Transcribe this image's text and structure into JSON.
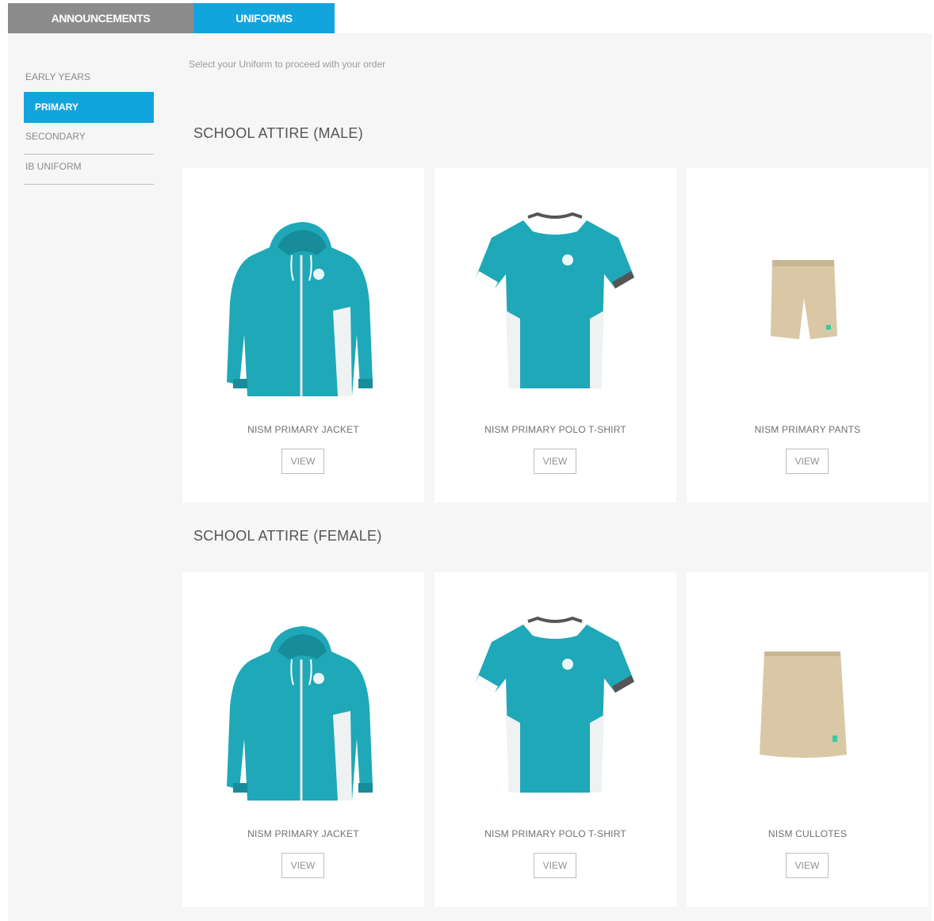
{
  "tabs": [
    {
      "label": "ANNOUNCEMENTS"
    },
    {
      "label": "UNIFORMS"
    }
  ],
  "sidebar": {
    "items": [
      {
        "label": "EARLY YEARS"
      },
      {
        "label": "PRIMARY"
      },
      {
        "label": "SECONDARY"
      },
      {
        "label": "IB UNIFORM"
      }
    ]
  },
  "intro": "Select your Uniform to proceed with your order",
  "sections": [
    {
      "title": "SCHOOL ATTIRE (MALE)",
      "products": [
        {
          "name": "NISM PRIMARY JACKET",
          "button": "VIEW"
        },
        {
          "name": "NISM PRIMARY POLO T-SHIRT",
          "button": "VIEW"
        },
        {
          "name": "NISM PRIMARY PANTS",
          "button": "VIEW"
        }
      ]
    },
    {
      "title": "SCHOOL ATTIRE (FEMALE)",
      "products": [
        {
          "name": "NISM PRIMARY JACKET",
          "button": "VIEW"
        },
        {
          "name": "NISM PRIMARY POLO T-SHIRT",
          "button": "VIEW"
        },
        {
          "name": "NISM CULLOTES",
          "button": "VIEW"
        }
      ]
    }
  ],
  "colors": {
    "accent": "#12a4dd",
    "teal": "#1fa8b8",
    "khaki": "#d9c7a6"
  }
}
